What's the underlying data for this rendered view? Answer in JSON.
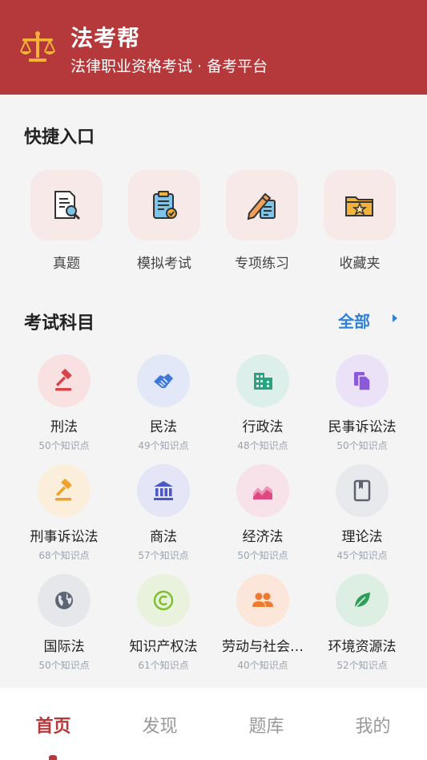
{
  "header": {
    "title": "法考帮",
    "subtitle": "法律职业资格考试 · 备考平台",
    "logo_icon": "scales-of-justice-icon",
    "bg_color": "#b5383a",
    "logo_color": "#f4b23a"
  },
  "quick_entry": {
    "title": "快捷入口",
    "items": [
      {
        "label": "真题",
        "icon": "document-search-icon"
      },
      {
        "label": "模拟考试",
        "icon": "clipboard-check-icon"
      },
      {
        "label": "专项练习",
        "icon": "pencil-note-icon"
      },
      {
        "label": "收藏夹",
        "icon": "folder-star-icon"
      }
    ]
  },
  "subjects": {
    "title": "考试科目",
    "all_label": "全部",
    "items": [
      {
        "name": "刑法",
        "count": "50个知识点",
        "icon": "gavel-icon",
        "bg": "#f9e1e1",
        "fg": "#d9434a"
      },
      {
        "name": "民法",
        "count": "49个知识点",
        "icon": "handshake-icon",
        "bg": "#e2e8f7",
        "fg": "#3f78d8"
      },
      {
        "name": "行政法",
        "count": "48个知识点",
        "icon": "building-icon",
        "bg": "#dcefea",
        "fg": "#2aa381"
      },
      {
        "name": "民事诉讼法",
        "count": "50个知识点",
        "icon": "copy-documents-icon",
        "bg": "#ece2f7",
        "fg": "#8a5ad9"
      },
      {
        "name": "刑事诉讼法",
        "count": "68个知识点",
        "icon": "gavel-icon",
        "bg": "#fbeedb",
        "fg": "#eea22a"
      },
      {
        "name": "商法",
        "count": "57个知识点",
        "icon": "bank-icon",
        "bg": "#e4e5f7",
        "fg": "#4b56c7"
      },
      {
        "name": "经济法",
        "count": "50个知识点",
        "icon": "line-chart-icon",
        "bg": "#f8e2ea",
        "fg": "#e04884"
      },
      {
        "name": "理论法",
        "count": "45个知识点",
        "icon": "book-icon",
        "bg": "#e7e9ec",
        "fg": "#5d6470"
      },
      {
        "name": "国际法",
        "count": "50个知识点",
        "icon": "globe-icon",
        "bg": "#e5e7ea",
        "fg": "#5d6675"
      },
      {
        "name": "知识产权法",
        "count": "61个知识点",
        "icon": "copyright-icon",
        "bg": "#e9f2dc",
        "fg": "#7fc02e"
      },
      {
        "name": "劳动与社会…",
        "count": "40个知识点",
        "icon": "people-icon",
        "bg": "#fbe6d9",
        "fg": "#ee7a30"
      },
      {
        "name": "环境资源法",
        "count": "52个知识点",
        "icon": "leaf-icon",
        "bg": "#ddeee3",
        "fg": "#2f9e5a"
      }
    ]
  },
  "tabbar": {
    "items": [
      "首页",
      "发现",
      "题库",
      "我的"
    ],
    "active": "首页"
  }
}
